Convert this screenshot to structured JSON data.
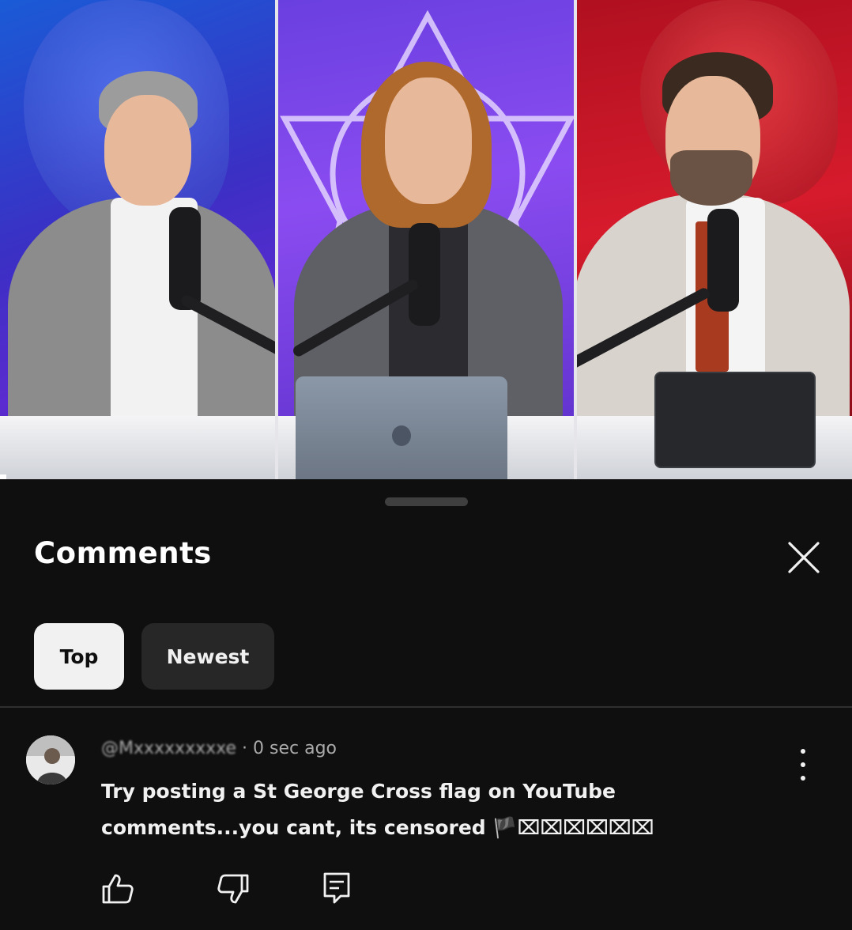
{
  "comments_sheet": {
    "title": "Comments",
    "close_icon": "close-icon",
    "filters": [
      {
        "label": "Top",
        "selected": true
      },
      {
        "label": "Newest",
        "selected": false
      }
    ]
  },
  "comment": {
    "handle": "@Mxxxxxxxxxe",
    "separator": "·",
    "time": "0 sec ago",
    "text": "Try posting a St George Cross flag on YouTube comments...you cant, its censored 🏴⌧⌧⌧⌧⌧⌧",
    "actions": {
      "like_icon": "thumbs-up-icon",
      "dislike_icon": "thumbs-down-icon",
      "reply_icon": "reply-icon",
      "more_icon": "more-vertical-icon"
    }
  },
  "colors": {
    "background": "#0f0f0f",
    "chip_selected": "#f1f1f1",
    "chip_unselected": "#272727",
    "meta_text": "#aaaaaa"
  }
}
